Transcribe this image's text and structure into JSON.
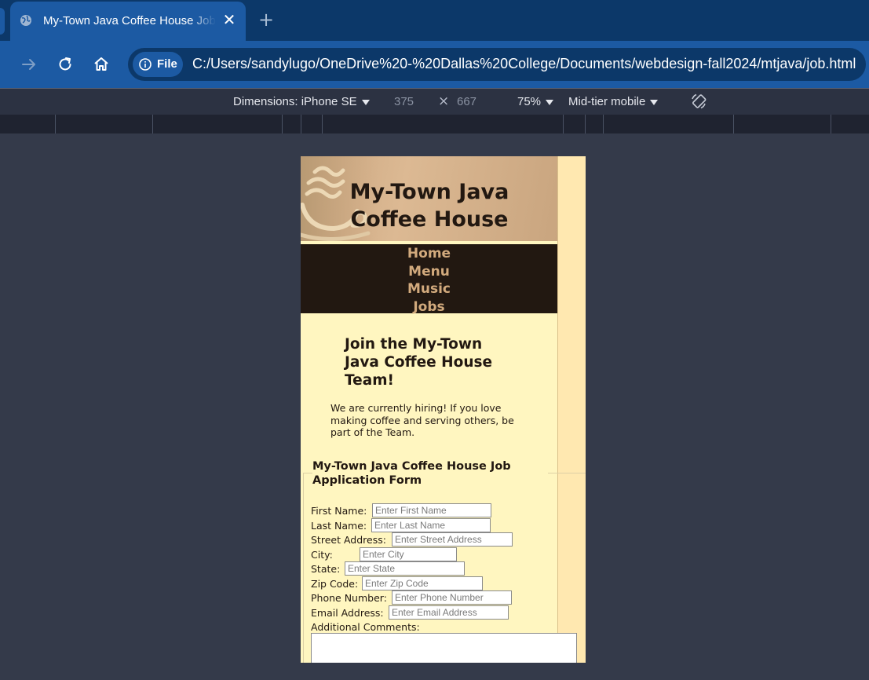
{
  "browser": {
    "tab_title": "My-Town Java Coffee House Job Application",
    "close_glyph": "✕",
    "newtab_glyph": "+",
    "site_info_label": "File",
    "url": "C:/Users/sandylugo/OneDrive%20-%20Dallas%20College/Documents/webdesign-fall2024/mtjava/job.html"
  },
  "devtools": {
    "device_label": "Dimensions: iPhone SE",
    "width_value": "375",
    "height_value": "667",
    "times_glyph": "×",
    "zoom_label": "75%",
    "throttle_label": "Mid-tier mobile"
  },
  "page": {
    "site_title": "My-Town Java Coffee House",
    "nav": [
      "Home",
      "Menu",
      "Music",
      "Jobs"
    ],
    "heading": "Join the My-Town Java Coffee House Team!",
    "intro": "We are currently hiring! If you love making coffee and serving others, be part of the Team.",
    "form": {
      "legend": "My-Town Java Coffee House Job Application Form",
      "fields": [
        {
          "label": "First Name:",
          "placeholder": "Enter First Name"
        },
        {
          "label": "Last Name:",
          "placeholder": "Enter Last Name"
        },
        {
          "label": "Street Address:",
          "placeholder": "Enter Street Address"
        },
        {
          "label": "City:",
          "placeholder": "Enter City"
        },
        {
          "label": "State:",
          "placeholder": "Enter State"
        },
        {
          "label": "Zip Code:",
          "placeholder": "Enter Zip Code"
        },
        {
          "label": "Phone Number:",
          "placeholder": "Enter Phone Number"
        },
        {
          "label": "Email Address:",
          "placeholder": "Enter Email Address"
        }
      ],
      "comments_label": "Additional Comments:"
    }
  },
  "colors": {
    "tabbar": "#0c3869",
    "toolbar": "#1c5aa3",
    "page_bg": "#fff6c0",
    "header_bg": "#c9a57f",
    "nav_bg": "#221811",
    "nav_link": "#d2aa7d",
    "text": "#221811"
  },
  "icons": [
    "globe-icon",
    "close-icon",
    "plus-icon",
    "forward-arrow-icon",
    "reload-icon",
    "home-icon",
    "info-icon",
    "caret-down-icon",
    "rotate-device-icon",
    "coffee-cup-icon"
  ]
}
